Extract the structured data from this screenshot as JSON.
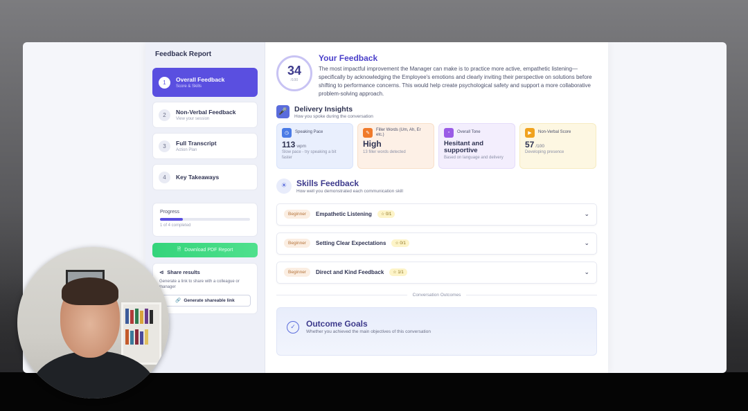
{
  "sidebar": {
    "title": "Feedback Report",
    "steps": [
      {
        "num": "1",
        "title": "Overall Feedback",
        "sub": "Score & Skills"
      },
      {
        "num": "2",
        "title": "Non-Verbal Feedback",
        "sub": "View your session"
      },
      {
        "num": "3",
        "title": "Full Transcript",
        "sub": "Action Plan"
      },
      {
        "num": "4",
        "title": "Key Takeaways",
        "sub": ""
      }
    ],
    "progress": {
      "label": "Progress",
      "completed_text": "1 of 4 completed",
      "fraction": 0.25
    },
    "download_label": "Download PDF Report",
    "share": {
      "title": "Share results",
      "desc": "Generate a link to share with a colleague or manager",
      "button": "Generate shareable link"
    }
  },
  "feedback": {
    "score": "34",
    "score_max": "/100",
    "title": "Your Feedback",
    "text": "The most impactful improvement the Manager can make is to practice more active, empathetic listening—specifically by acknowledging the Employee's emotions and clearly inviting their perspective on solutions before shifting to performance concerns. This would help create psychological safety and support a more collaborative problem-solving approach."
  },
  "delivery": {
    "title": "Delivery Insights",
    "sub": "How you spoke during the conversation",
    "cards": [
      {
        "label": "Speaking Pace",
        "value": "113",
        "unit": "wpm",
        "note": "Slow pace - try speaking a bit faster",
        "icon": "clock-icon",
        "color": "#4a7be6"
      },
      {
        "label": "Filler Words (Um, Ah, Er etc.)",
        "value": "High",
        "unit": "",
        "note": "13 filler words detected",
        "icon": "message-icon",
        "color": "#f07a2a"
      },
      {
        "label": "Overall Tone",
        "value": "Hesitant and supportive",
        "unit": "",
        "note": "Based on language and delivery",
        "icon": "chat-icon",
        "color": "#9a5be6"
      },
      {
        "label": "Non-Verbal Score",
        "value": "57",
        "unit": "/100",
        "note": "Developing presence",
        "icon": "video-icon",
        "color": "#f0a21e"
      }
    ]
  },
  "skills": {
    "title": "Skills Feedback",
    "sub": "How well you demonstrated each communication skill",
    "items": [
      {
        "level": "Beginner",
        "name": "Empathetic Listening",
        "score": "☆ 0/1"
      },
      {
        "level": "Beginner",
        "name": "Setting Clear Expectations",
        "score": "☆ 0/1"
      },
      {
        "level": "Beginner",
        "name": "Direct and Kind Feedback",
        "score": "☆ 1/1"
      }
    ]
  },
  "outcomes": {
    "divider": "Conversation Outcomes",
    "title": "Outcome Goals",
    "sub": "Whether you achieved the main objectives of this conversation"
  }
}
